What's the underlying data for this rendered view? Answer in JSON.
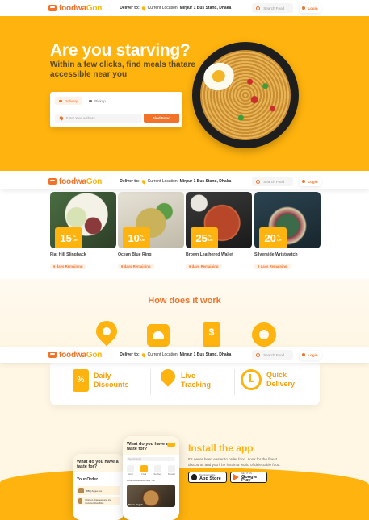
{
  "brand": {
    "name_first": "foodwa",
    "name_second": "Gon",
    "primary_color": "#f17228",
    "accent_color": "#ffb30e"
  },
  "header": {
    "deliver_label": "Deliver to:",
    "location_prefix": "Current Location",
    "location_value": "Mirpur 1 Bus Stand, Dhaka",
    "search_placeholder": "Search Food",
    "login_label": "Login"
  },
  "hero": {
    "title": "Are you starving?",
    "subtitle": "Within a few clicks, find meals thatare accessible near you",
    "tabs": [
      {
        "label": "Delivery",
        "icon": "motorbike-icon"
      },
      {
        "label": "Pickup",
        "icon": "bag-icon"
      }
    ],
    "address_placeholder": "Enter Your Address",
    "find_button": "Find Food"
  },
  "offers": [
    {
      "discount": "15",
      "unit": "%",
      "off": "Off",
      "name": "Flat Hill Slingback",
      "remaining": "6 days Remaining"
    },
    {
      "discount": "10",
      "unit": "%",
      "off": "Off",
      "name": "Ocean Blue Ring",
      "remaining": "6 days Remaining"
    },
    {
      "discount": "25",
      "unit": "%",
      "off": "Off",
      "name": "Brown Leathered Wallet",
      "remaining": "6 days Remaining"
    },
    {
      "discount": "20",
      "unit": "%",
      "off": "Off",
      "name": "Silverside Wristwatch",
      "remaining": "6 days Remaining"
    }
  ],
  "how_it_works": {
    "title": "How does it work",
    "icons": [
      "location-icon",
      "order-bell-icon",
      "receipt-icon",
      "donut-icon"
    ]
  },
  "features": [
    {
      "line1": "Daily",
      "line2": "Discounts",
      "icon": "discount-tag-icon"
    },
    {
      "line1": "Live",
      "line2": "Tracking",
      "icon": "location-pin-icon"
    },
    {
      "line1": "Quick",
      "line2": "Delivery",
      "icon": "clock-icon"
    }
  ],
  "install": {
    "title": "Install the app",
    "description": "It's never been easier to order food. Look for the finest discounts and you'll be lost in a world of delectable food.",
    "app_store": {
      "small": "Download on the",
      "big": "App Store"
    },
    "google_play": {
      "small": "GET IT ON",
      "big": "Google Play"
    }
  },
  "phone_main": {
    "headline": "What do you have a taste for?",
    "search": "Search Food",
    "categories": [
      "Donut",
      "Food",
      "Seafood",
      "Dessert"
    ],
    "section": "Local Restaurants Near You",
    "food_label": "Rick's Bagels"
  },
  "phone_back": {
    "headline": "What do you have a taste for?",
    "order_title": "Your Order",
    "items": [
      "BBQ Angus Ica",
      "Chicken, Cashew, and Ice Coconut Rice Dish"
    ]
  }
}
